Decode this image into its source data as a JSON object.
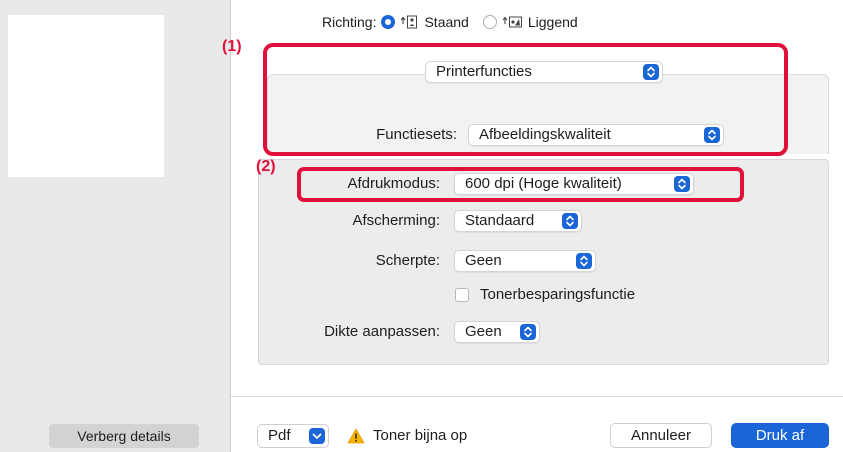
{
  "orientation": {
    "label": "Richting:",
    "portrait": "Staand",
    "landscape": "Liggend",
    "selected": "Staand"
  },
  "callouts": {
    "first": "(1)",
    "second": "(2)"
  },
  "panel": {
    "printer_functions": "Printerfuncties",
    "feature_sets_label": "Functiesets:",
    "feature_sets_value": "Afbeeldingskwaliteit",
    "print_mode_label": "Afdrukmodus:",
    "print_mode_value": "600 dpi (Hoge kwaliteit)",
    "screening_label": "Afscherming:",
    "screening_value": "Standaard",
    "sharpness_label": "Scherpte:",
    "sharpness_value": "Geen",
    "toner_save_label": "Tonerbesparingsfunctie",
    "toner_save_checked": false,
    "thickness_label": "Dikte aanpassen:",
    "thickness_value": "Geen"
  },
  "footer": {
    "hide_details": "Verberg details",
    "pdf": "Pdf",
    "toner_warning": "Toner bijna op",
    "cancel": "Annuleer",
    "print": "Druk af"
  },
  "colors": {
    "accent": "#1a66d6",
    "highlight": "#e0103a",
    "warning": "#f5b400"
  }
}
